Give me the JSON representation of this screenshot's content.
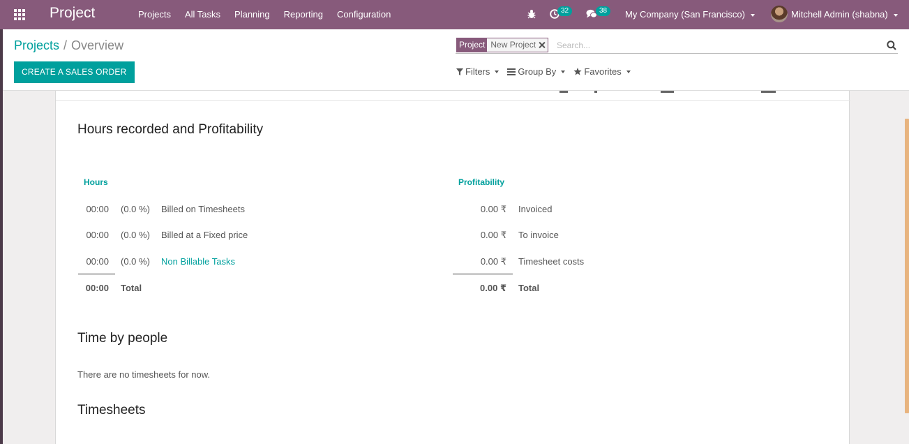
{
  "navbar": {
    "app_title": "Project",
    "menu": [
      "Projects",
      "All Tasks",
      "Planning",
      "Reporting",
      "Configuration"
    ],
    "activity_count": "32",
    "message_count": "38",
    "company": "My Company (San Francisco)",
    "user": "Mitchell Admin (shabna)"
  },
  "breadcrumb": {
    "parent": "Projects",
    "separator": "/",
    "current": "Overview"
  },
  "actions": {
    "create_sales_order": "CREATE A SALES ORDER"
  },
  "search": {
    "facet_category": "Project",
    "facet_value": "New Project",
    "placeholder": "Search..."
  },
  "filters": {
    "filters": "Filters",
    "group_by": "Group By",
    "favorites": "Favorites"
  },
  "sections": {
    "hours_profitability": "Hours recorded and Profitability",
    "time_by_people": "Time by people",
    "timesheets": "Timesheets"
  },
  "hours": {
    "header": "Hours",
    "rows": [
      {
        "time": "00:00",
        "pct": "(0.0 %)",
        "label": "Billed on Timesheets"
      },
      {
        "time": "00:00",
        "pct": "(0.0 %)",
        "label": "Billed at a Fixed price"
      },
      {
        "time": "00:00",
        "pct": "(0.0 %)",
        "label": "Non Billable Tasks"
      }
    ],
    "total_time": "00:00",
    "total_label": "Total"
  },
  "profitability": {
    "header": "Profitability",
    "rows": [
      {
        "amount": "0.00 ₹",
        "label": "Invoiced"
      },
      {
        "amount": "0.00 ₹",
        "label": "To invoice"
      },
      {
        "amount": "0.00 ₹",
        "label": "Timesheet costs"
      }
    ],
    "total_amount": "0.00 ₹",
    "total_label": "Total"
  },
  "time_by_people": {
    "empty": "There are no timesheets for now."
  },
  "colors": {
    "brand": "#875a7b",
    "accent": "#00a09d"
  }
}
